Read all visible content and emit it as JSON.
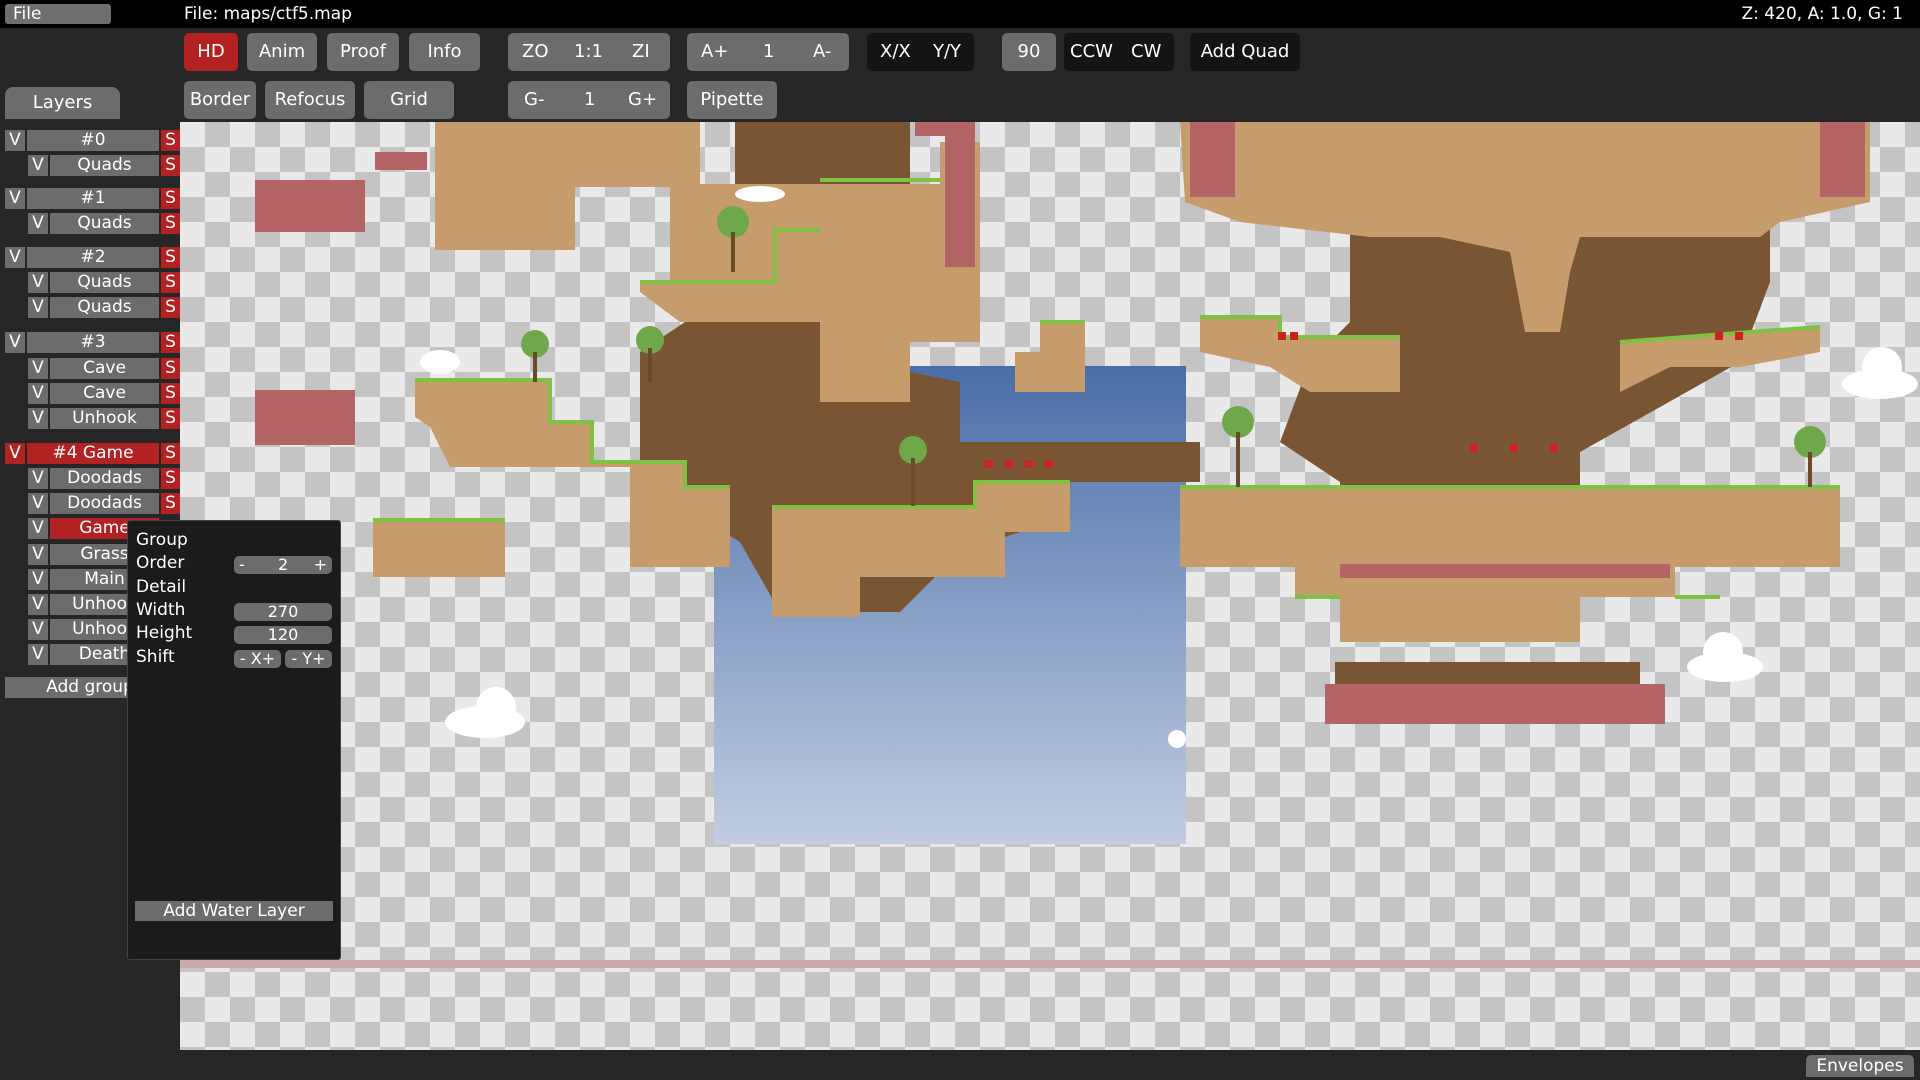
{
  "menu": {
    "file": "File"
  },
  "title": {
    "file_path": "File: maps/ctf5.map"
  },
  "status": {
    "text": "Z: 420, A: 1.0, G: 1"
  },
  "toolbar": {
    "hd": "HD",
    "anim": "Anim",
    "proof": "Proof",
    "info": "Info",
    "zoom_out": "ZO",
    "zoom_reset": "1:1",
    "zoom_in": "ZI",
    "anim_faster": "A+",
    "anim_speed": "1",
    "anim_slower": "A-",
    "flip_x": "X/X",
    "flip_y": "Y/Y",
    "rotate_angle": "90",
    "ccw": "CCW",
    "cw": "CW",
    "add_quad": "Add Quad",
    "border": "Border",
    "refocus": "Refocus",
    "grid": "Grid",
    "grid_minus": "G-",
    "grid_factor": "1",
    "grid_plus": "G+",
    "pipette": "Pipette"
  },
  "layers": {
    "tab": "Layers",
    "visible": "V",
    "solo": "S",
    "groups": [
      {
        "name": "#0",
        "layers": [
          "Quads"
        ]
      },
      {
        "name": "#1",
        "layers": [
          "Quads"
        ]
      },
      {
        "name": "#2",
        "layers": [
          "Quads",
          "Quads"
        ]
      },
      {
        "name": "#3",
        "layers": [
          "Cave",
          "Cave",
          "Unhook"
        ]
      },
      {
        "name": "#4 Game",
        "layers": [
          "Doodads",
          "Doodads",
          "Game",
          "Grass",
          "Main",
          "Unhook",
          "Unhook",
          "Death"
        ]
      }
    ],
    "add_group": "Add group"
  },
  "popup": {
    "group": "Group",
    "order": "Order",
    "order_minus": "-",
    "order_value": "2",
    "order_plus": "+",
    "detail": "Detail",
    "width": "Width",
    "width_value": "270",
    "height": "Height",
    "height_value": "120",
    "shift": "Shift",
    "shift_x": "- X+",
    "shift_y": "- Y+",
    "add_water_layer": "Add Water Layer"
  },
  "envelopes": "Envelopes",
  "colors": {
    "accent_red": "#b32222",
    "button_gray": "#6c6c6c",
    "ground": "#c69c6d",
    "grass": "#7dc242"
  }
}
